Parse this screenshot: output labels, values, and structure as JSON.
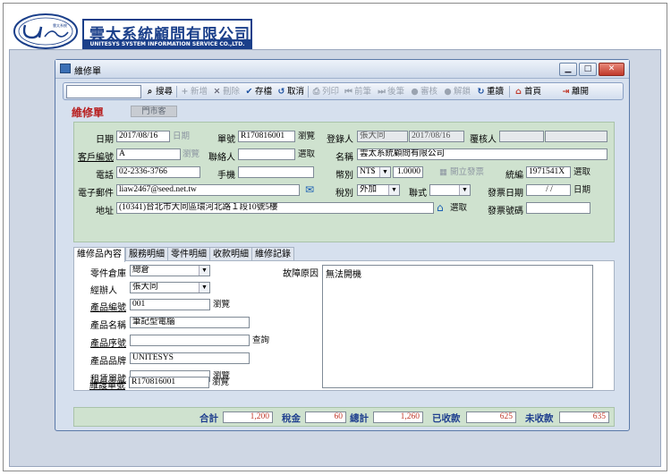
{
  "brand": {
    "company_zh": "雲太系統顧問有限公司",
    "company_en": "UNITESYS SYSTEM INFORMATION SERVICE CO.,LTD.",
    "logo_text": "Unitesys"
  },
  "window": {
    "title": "維修單",
    "controls": [
      "minimize",
      "maximize",
      "close"
    ]
  },
  "toolbar": {
    "search_value": "",
    "items": [
      {
        "label": "搜尋",
        "icon": "search-icon",
        "enabled": true
      },
      {
        "label": "新增",
        "icon": "plus-icon",
        "enabled": false
      },
      {
        "label": "刪除",
        "icon": "x-icon",
        "enabled": false
      },
      {
        "label": "存檔",
        "icon": "check-icon",
        "enabled": true
      },
      {
        "label": "取消",
        "icon": "undo-icon",
        "enabled": true
      },
      {
        "label": "列印",
        "icon": "printer-icon",
        "enabled": false
      },
      {
        "label": "前筆",
        "icon": "prev-icon",
        "enabled": false
      },
      {
        "label": "後筆",
        "icon": "next-icon",
        "enabled": false
      },
      {
        "label": "審核",
        "icon": "lock-icon",
        "enabled": false
      },
      {
        "label": "解鎖",
        "icon": "unlock-icon",
        "enabled": false
      },
      {
        "label": "重讀",
        "icon": "refresh-icon",
        "enabled": true
      },
      {
        "label": "首頁",
        "icon": "home-icon",
        "enabled": true
      },
      {
        "label": "離開",
        "icon": "exit-icon",
        "enabled": true
      }
    ]
  },
  "header": {
    "title": "維修單",
    "tag": "門市客"
  },
  "form": {
    "date_label": "日期",
    "date_value": "2017/08/16",
    "date_btn": "日期",
    "no_label": "單號",
    "no_value": "R170816001",
    "no_btn": "瀏覽",
    "registrar_label": "登錄人",
    "registrar_value": "張大同",
    "registrar_date": "2017/08/16",
    "reviewer_label": "覆核人",
    "reviewer_value": "",
    "cust_no_label": "客戶編號",
    "cust_no_value": "A",
    "cust_no_btn": "瀏覽",
    "contact_label": "聯絡人",
    "contact_value": "",
    "contact_btn": "選取",
    "name_label": "名稱",
    "name_value": "雲太系統顧問有限公司",
    "phone_label": "電話",
    "phone_value": "02-2336-3766",
    "mobile_label": "手機",
    "mobile_value": "",
    "currency_label": "幣別",
    "currency_value": "NT$",
    "rate_value": "1.0000",
    "invoice_btn": "開立發票",
    "tax_id_label": "統編",
    "tax_id_value": "1971541X",
    "tax_id_btn": "選取",
    "email_label": "電子郵件",
    "email_value": "liaw2467@seed.net.tw",
    "tax_label": "稅別",
    "tax_value": "外加",
    "format_label": "聯式",
    "format_value": "",
    "invoice_date_label": "發票日期",
    "invoice_date_value": "/ /",
    "invoice_date_btn": "日期",
    "address_label": "地址",
    "address_value": "(10341)台北市大同區環河北路１段10號5樓",
    "address_btn": "選取",
    "invoice_no_label": "發票號碼",
    "invoice_no_value": ""
  },
  "tabs": [
    {
      "label": "維修品內容",
      "active": true
    },
    {
      "label": "服務明細",
      "active": false
    },
    {
      "label": "零件明細",
      "active": false
    },
    {
      "label": "收款明細",
      "active": false
    },
    {
      "label": "維修記錄",
      "active": false
    }
  ],
  "item": {
    "warehouse_label": "零件倉庫",
    "warehouse_value": "總倉",
    "handler_label": "經辦人",
    "handler_value": "張大同",
    "product_no_label": "產品編號",
    "product_no_value": "001",
    "product_no_btn": "瀏覽",
    "product_name_label": "產品名稱",
    "product_name_value": "筆記型電腦",
    "serial_label": "產品序號",
    "serial_value": "",
    "serial_btn": "查詢",
    "brand_label": "產品品牌",
    "brand_value": "UNITESYS",
    "rental_no_label": "租賃單號",
    "rental_no_value": "",
    "rental_no_btn": "瀏覽",
    "maint_no_label": "維護單號",
    "maint_no_value": "R170816001",
    "maint_no_btn": "瀏覽",
    "fault_label": "故障原因",
    "fault_value": "無法開機"
  },
  "totals": {
    "subtotal_label": "合計",
    "subtotal_value": "1,200",
    "tax_label": "稅金",
    "tax_value": "60",
    "total_label": "總計",
    "total_value": "1,260",
    "received_label": "已收款",
    "received_value": "625",
    "unreceived_label": "未收款",
    "unreceived_value": "635"
  },
  "colors": {
    "accent_blue": "#1a3f8a",
    "title_red": "#b71c1c",
    "form_green": "#cfe2cf",
    "amount_red": "#c0392b"
  }
}
